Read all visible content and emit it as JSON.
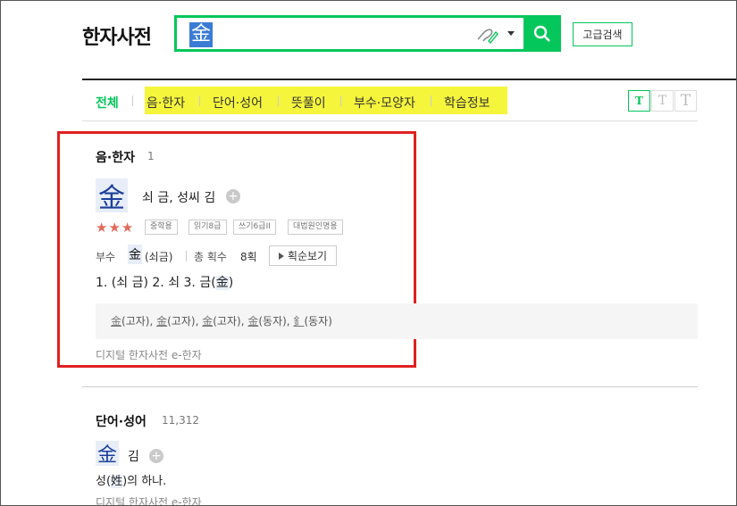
{
  "header": {
    "logo": "한자사전",
    "search_value": "金",
    "advanced_search_label": "고급검색"
  },
  "tabs": {
    "active": "전체",
    "items": [
      "음·한자",
      "단어·성어",
      "뜻풀이",
      "부수·모양자",
      "학습정보"
    ]
  },
  "font_size_buttons": [
    "T",
    "T",
    "T"
  ],
  "section_hanja": {
    "title": "음·한자",
    "count": "1",
    "character": "金",
    "reading": "쇠 금, 성씨 김",
    "stars": "★★★",
    "badges": [
      "중학용",
      "읽기8급",
      "쓰기6급II",
      "대법원인명용"
    ],
    "radical_label": "부수",
    "radical_char": "金",
    "radical_reading": "(쇠금)",
    "stroke_label": "총 획수",
    "stroke_value": "8획",
    "stroke_button": "획순보기",
    "meanings_prefix": "1. (쇠 금)  2. 쇠  3. 금(",
    "meanings_char": "金",
    "meanings_suffix": ")",
    "variants": [
      {
        "char": "金",
        "type": "(고자)"
      },
      {
        "char": "金",
        "type": "(고자)"
      },
      {
        "char": "金",
        "type": "(고자)"
      },
      {
        "char": "金",
        "type": "(동자)"
      },
      {
        "char": "釒",
        "type": "(동자)"
      }
    ],
    "source": "디지털 한자사전 e-한자"
  },
  "section_words": {
    "title": "단어·성어",
    "count": "11,312",
    "character": "金",
    "reading": "김",
    "meaning_prefix": "성(",
    "meaning_char": "姓",
    "meaning_suffix": ")의 하나.",
    "source": "디지털 한자사전 e-한자"
  },
  "colors": {
    "accent": "#03c75a",
    "highlight": "#f5f53c",
    "annotation_box": "#e02020",
    "stars": "#e06a5a"
  }
}
